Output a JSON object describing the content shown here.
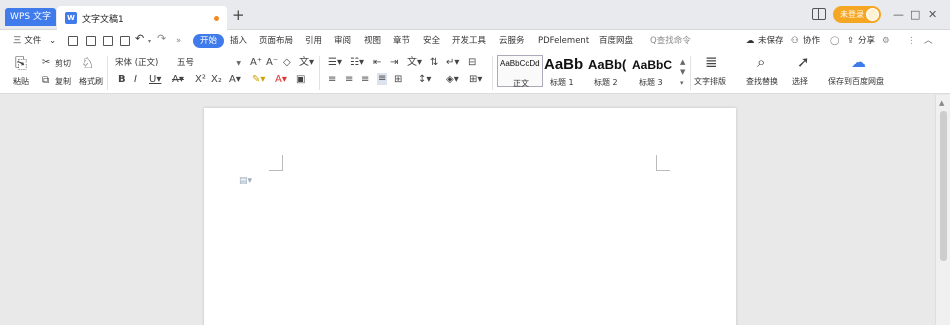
{
  "titlebar": {
    "app_tab": "WPS 文字",
    "doc_tab": "文字文稿1",
    "doc_icon": "W",
    "new_tab": "+",
    "login": "未登录",
    "minimize": "—",
    "maximize": "□",
    "close": "✕"
  },
  "menubar": {
    "file": "三 文件",
    "file_arrow": "⌄",
    "tabs": [
      "开始",
      "插入",
      "页面布局",
      "引用",
      "审阅",
      "视图",
      "章节",
      "安全",
      "开发工具",
      "云服务",
      "PDFelement",
      "百度网盘"
    ],
    "search_cmd": "Q查找命令",
    "unsaved": "未保存",
    "collab": "协作",
    "share": "分享"
  },
  "ribbon": {
    "paste": "粘贴",
    "cut": "剪切",
    "copy": "复制",
    "format_painter": "格式刷",
    "font_name": "宋体 (正文)",
    "font_size": "五号",
    "styles": [
      {
        "sample": "AaBbCcDd",
        "name": "正文"
      },
      {
        "sample": "AaBb",
        "name": "标题 1"
      },
      {
        "sample": "AaBb(",
        "name": "标题 2"
      },
      {
        "sample": "AaBbC",
        "name": "标题 3"
      }
    ],
    "text_layout": "文字排版",
    "find_replace": "查找替换",
    "select": "选择",
    "save_baidu": "保存到百度网盘"
  }
}
